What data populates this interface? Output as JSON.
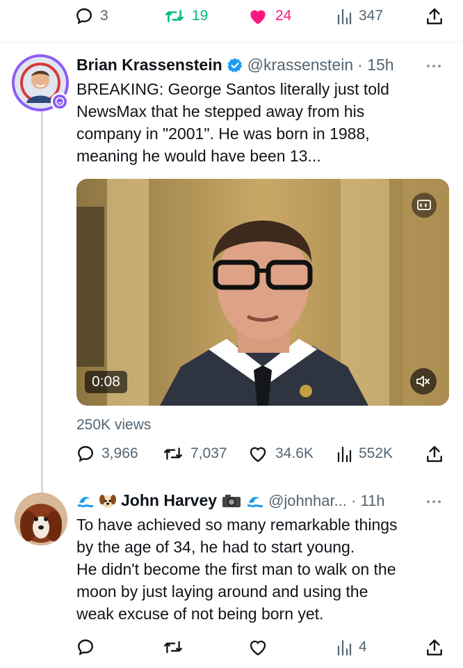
{
  "top_bar": {
    "replies": "3",
    "retweets": "19",
    "likes": "24",
    "views": "347"
  },
  "main_tweet": {
    "author_name": "Brian Krassenstein",
    "handle": "@krassenstein",
    "time": "· 15h",
    "text_lines": [
      "BREAKING: George Santos literally just told",
      "NewsMax that he stepped away from his",
      "company in \"2001\".  He was born in 1988,",
      "meaning he would have been 13..."
    ],
    "video_time": "0:08",
    "views_label": "250K views",
    "replies": "3,966",
    "retweets": "7,037",
    "likes": "34.6K",
    "views": "552K"
  },
  "reply_tweet": {
    "author_name": "John Harvey",
    "handle": "@johnhar... · 11h",
    "text_lines": [
      "To have achieved so many remarkable things",
      "by the age of 34, he had to start young.",
      "He didn't become the first man to walk on the",
      "moon by just laying around and using the",
      "weak excuse of not being born yet."
    ],
    "views": "4"
  },
  "colors": {
    "like_pink": "#f91880",
    "retweet_green": "#00ba7c",
    "verified_blue": "#1d9bf0",
    "muted": "#536471"
  },
  "icons": [
    "reply-icon",
    "retweet-icon",
    "like-icon",
    "views-icon",
    "share-icon",
    "verified-icon",
    "more-icon",
    "captions-icon",
    "mute-icon"
  ]
}
